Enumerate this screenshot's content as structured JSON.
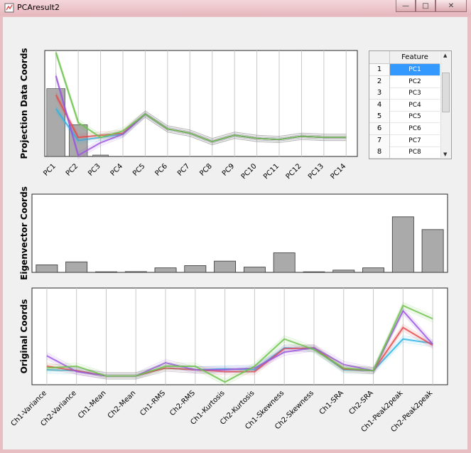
{
  "window": {
    "title": "PCAresult2",
    "buttons": {
      "minimize": "—",
      "maximize": "□",
      "close": "✕"
    }
  },
  "colors": {
    "bar_fill": "#aaaaaa",
    "bar_stroke": "#333333",
    "series_colors": [
      "#2bb4e8",
      "#e84a4a",
      "#9b55e0",
      "#6cc24a"
    ]
  },
  "chart_data": [
    {
      "type": "line",
      "ylabel": "Projection Data Coords",
      "categories": [
        "PC1",
        "PC2",
        "PC3",
        "PC4",
        "PC5",
        "PC6",
        "PC7",
        "PC8",
        "PC9",
        "PC10",
        "PC11",
        "PC12",
        "PC13",
        "PC14"
      ],
      "bars": [
        0.64,
        0.3,
        0.0,
        0,
        0,
        0,
        0,
        0,
        0,
        0,
        0,
        0,
        0,
        0
      ],
      "series": [
        {
          "values": [
            0.45,
            0.15,
            0.18,
            0.21,
            0.4,
            0.26,
            0.22,
            0.14,
            0.2,
            0.17,
            0.16,
            0.19,
            0.18,
            0.18
          ]
        },
        {
          "values": [
            0.58,
            0.18,
            0.2,
            0.22,
            0.4,
            0.26,
            0.22,
            0.14,
            0.2,
            0.17,
            0.16,
            0.19,
            0.18,
            0.18
          ]
        },
        {
          "values": [
            0.76,
            0.01,
            0.13,
            0.21,
            0.4,
            0.26,
            0.22,
            0.14,
            0.2,
            0.17,
            0.16,
            0.19,
            0.18,
            0.18
          ]
        },
        {
          "values": [
            0.98,
            0.32,
            0.18,
            0.24,
            0.4,
            0.26,
            0.22,
            0.14,
            0.2,
            0.17,
            0.16,
            0.19,
            0.18,
            0.18
          ]
        }
      ],
      "ylim": [
        0,
        1
      ]
    },
    {
      "type": "bar",
      "ylabel": "Eigenvector Coords",
      "categories": [
        "Ch1-Variance",
        "Ch2-Variance",
        "Ch1-Mean",
        "Ch2-Mean",
        "Ch1-RMS",
        "Ch2-RMS",
        "Ch1-Kurtosis",
        "Ch2-Kurtosis",
        "Ch1-Skewness",
        "Ch2-Skewness",
        "Ch1-SRA",
        "Ch2-SRA",
        "Ch1-Peak2peak",
        "Ch2-Peak2peak"
      ],
      "values": [
        0.1,
        0.14,
        0.005,
        0.01,
        0.06,
        0.09,
        0.15,
        0.07,
        0.26,
        0.005,
        0.03,
        0.06,
        0.74,
        0.57
      ],
      "ylim": [
        0,
        1
      ]
    },
    {
      "type": "line",
      "ylabel": "Original Coords",
      "categories": [
        "Ch1-Variance",
        "Ch2-Variance",
        "Ch1-Mean",
        "Ch2-Mean",
        "Ch1-RMS",
        "Ch2-RMS",
        "Ch1-Kurtosis",
        "Ch2-Kurtosis",
        "Ch1-Skewness",
        "Ch2-Skewness",
        "Ch1-SRA",
        "Ch2-SRA",
        "Ch1-Peak2peak",
        "Ch2-Peak2peak"
      ],
      "series": [
        {
          "values": [
            0.07,
            0.06,
            0.0,
            0.0,
            0.09,
            0.07,
            0.08,
            0.07,
            0.32,
            0.31,
            0.07,
            0.06,
            0.42,
            0.37
          ]
        },
        {
          "values": [
            0.11,
            0.06,
            0.0,
            0.0,
            0.09,
            0.07,
            0.05,
            0.05,
            0.31,
            0.32,
            0.08,
            0.06,
            0.55,
            0.35
          ]
        },
        {
          "values": [
            0.23,
            0.05,
            0.0,
            0.0,
            0.15,
            0.07,
            0.07,
            0.09,
            0.27,
            0.32,
            0.13,
            0.06,
            0.74,
            0.36
          ]
        },
        {
          "values": [
            0.09,
            0.11,
            0.0,
            0.0,
            0.11,
            0.11,
            -0.07,
            0.11,
            0.42,
            0.3,
            0.09,
            0.06,
            0.8,
            0.65
          ]
        }
      ],
      "ylim": [
        -0.1,
        1
      ]
    }
  ],
  "table": {
    "header": "Feature",
    "rows": [
      {
        "num": "1",
        "value": "PC1",
        "selected": true
      },
      {
        "num": "2",
        "value": "PC2",
        "selected": false
      },
      {
        "num": "3",
        "value": "PC3",
        "selected": false
      },
      {
        "num": "4",
        "value": "PC4",
        "selected": false
      },
      {
        "num": "5",
        "value": "PC5",
        "selected": false
      },
      {
        "num": "6",
        "value": "PC6",
        "selected": false
      },
      {
        "num": "7",
        "value": "PC7",
        "selected": false
      },
      {
        "num": "8",
        "value": "PC8",
        "selected": false
      }
    ],
    "scroll_up": "▲",
    "scroll_down": "▼"
  }
}
